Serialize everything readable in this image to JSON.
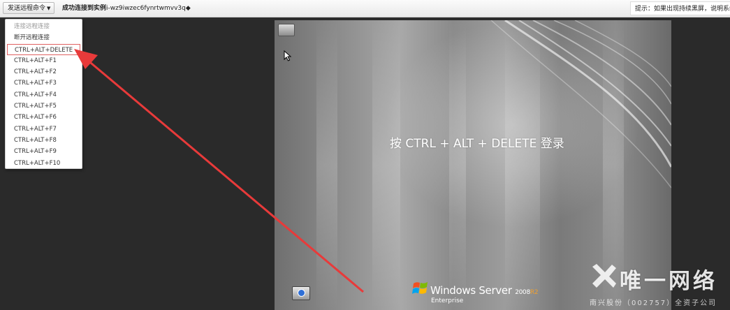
{
  "toolbar": {
    "send_command_label": "发送远程命令",
    "status_prefix": "成功连接到实例",
    "instance_id": "i-wz9iwzec6fynrtwmvv3q",
    "status_suffix": "◆",
    "hint": "提示：如果出现持续黑屏，说明系统"
  },
  "dropdown": {
    "items": [
      {
        "label": "连接远程连接",
        "disabled": true
      },
      {
        "label": "断开远程连接",
        "disabled": false
      },
      {
        "label": "CTRL+ALT+DELETE",
        "disabled": false,
        "highlighted": true
      },
      {
        "label": "CTRL+ALT+F1"
      },
      {
        "label": "CTRL+ALT+F2"
      },
      {
        "label": "CTRL+ALT+F3"
      },
      {
        "label": "CTRL+ALT+F4"
      },
      {
        "label": "CTRL+ALT+F5"
      },
      {
        "label": "CTRL+ALT+F6"
      },
      {
        "label": "CTRL+ALT+F7"
      },
      {
        "label": "CTRL+ALT+F8"
      },
      {
        "label": "CTRL+ALT+F9"
      },
      {
        "label": "CTRL+ALT+F10"
      }
    ]
  },
  "remote_screen": {
    "login_prompt": "按 CTRL + ALT + DELETE 登录",
    "brand_windows": "Windows Server",
    "brand_version": "2008",
    "brand_release": "R2",
    "brand_edition": "Enterprise"
  },
  "watermark": {
    "main": "唯一网络",
    "sub": "南兴股份（002757）全资子公司"
  },
  "colors": {
    "highlight_border": "#e06060",
    "arrow": "#e83a3a",
    "page_background": "#2a2a2a"
  }
}
